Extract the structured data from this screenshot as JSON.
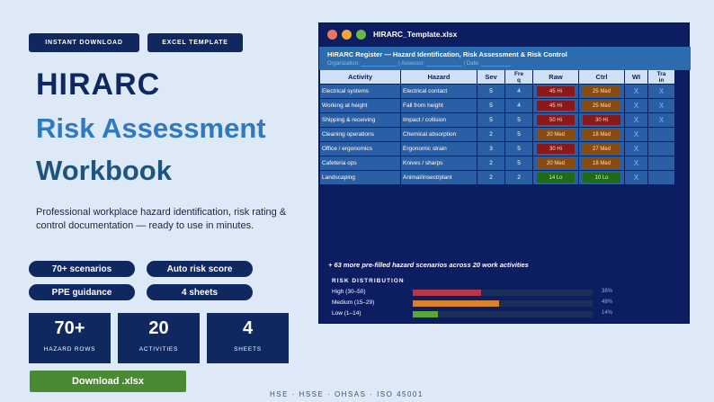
{
  "tags": [
    "INSTANT DOWNLOAD",
    "EXCEL TEMPLATE"
  ],
  "title": {
    "line1": "HIRARC",
    "line2": "Risk Assessment",
    "line3": "Workbook"
  },
  "description": "Professional workplace hazard identification, risk rating & control documentation — ready to use in minutes.",
  "pills": [
    "70+ scenarios",
    "Auto risk score",
    "PPE guidance",
    "4 sheets"
  ],
  "stats": [
    {
      "num": "70+",
      "label": "HAZARD ROWS"
    },
    {
      "num": "20",
      "label": "ACTIVITIES"
    },
    {
      "num": "4",
      "label": "SHEETS"
    }
  ],
  "download_label": "Download .xlsx",
  "footer": "HSE · HSSE · OHSAS · ISO 45001",
  "window": {
    "filename": "HIRARC_Template.xlsx",
    "dots": [
      "#e8765e",
      "#f2a638",
      "#6cb64a"
    ],
    "register_title": "HIRARC Register — Hazard Identification, Risk Assessment & Risk Control",
    "register_meta": "Organization: ____________   |   Assessor: ____________   |   Date: __________",
    "columns": [
      "Activity",
      "Hazard",
      "Sev",
      "Freq",
      "Raw",
      "Ctrl",
      "WI",
      "Train"
    ],
    "rows": [
      {
        "activity": "Electrical systems",
        "hazard": "Electrical contact",
        "sev": "5",
        "freq": "4",
        "raw": "45 Hi",
        "raw_level": "hi",
        "ctrl": "25 Med",
        "ctrl_level": "med",
        "wi": "X",
        "train": "X"
      },
      {
        "activity": "Working at height",
        "hazard": "Fall from height",
        "sev": "5",
        "freq": "4",
        "raw": "45 Hi",
        "raw_level": "hi",
        "ctrl": "25 Med",
        "ctrl_level": "med",
        "wi": "X",
        "train": "X"
      },
      {
        "activity": "Shipping & receiving",
        "hazard": "Impact / collision",
        "sev": "5",
        "freq": "5",
        "raw": "50 Hi",
        "raw_level": "hi",
        "ctrl": "30 Hi",
        "ctrl_level": "hi",
        "wi": "X",
        "train": "X"
      },
      {
        "activity": "Cleaning operations",
        "hazard": "Chemical absorption",
        "sev": "2",
        "freq": "5",
        "raw": "20 Med",
        "raw_level": "med",
        "ctrl": "18 Med",
        "ctrl_level": "med",
        "wi": "X",
        "train": ""
      },
      {
        "activity": "Office / ergonomics",
        "hazard": "Ergonomic strain",
        "sev": "3",
        "freq": "5",
        "raw": "30 Hi",
        "raw_level": "hi",
        "ctrl": "27 Med",
        "ctrl_level": "med",
        "wi": "X",
        "train": ""
      },
      {
        "activity": "Cafeteria ops",
        "hazard": "Knives / sharps",
        "sev": "2",
        "freq": "5",
        "raw": "20 Med",
        "raw_level": "med",
        "ctrl": "18 Med",
        "ctrl_level": "med",
        "wi": "X",
        "train": ""
      },
      {
        "activity": "Landscaping",
        "hazard": "Animal/insect/plant",
        "sev": "2",
        "freq": "2",
        "raw": "14 Lo",
        "raw_level": "lo",
        "ctrl": "10 Lo",
        "ctrl_level": "lo",
        "wi": "X",
        "train": ""
      }
    ],
    "more_text": "+ 63 more pre-filled hazard scenarios across 20 work activities",
    "risk_title": "RISK DISTRIBUTION",
    "risk": [
      {
        "label": "High (30–50)",
        "value": 38,
        "unit": "%",
        "color": "#b8364a"
      },
      {
        "label": "Medium (15–29)",
        "value": 48,
        "unit": "%",
        "color": "#d8832a"
      },
      {
        "label": "Low (1–14)",
        "value": 14,
        "unit": "%",
        "color": "#5aa83a"
      }
    ],
    "level_colors": {
      "hi": {
        "bg": "#8a1818",
        "fg": "#ffd9d0"
      },
      "med": {
        "bg": "#8a4a10",
        "fg": "#ffe2b0"
      },
      "lo": {
        "bg": "#1f6a18",
        "fg": "#d8f6c8"
      }
    }
  }
}
